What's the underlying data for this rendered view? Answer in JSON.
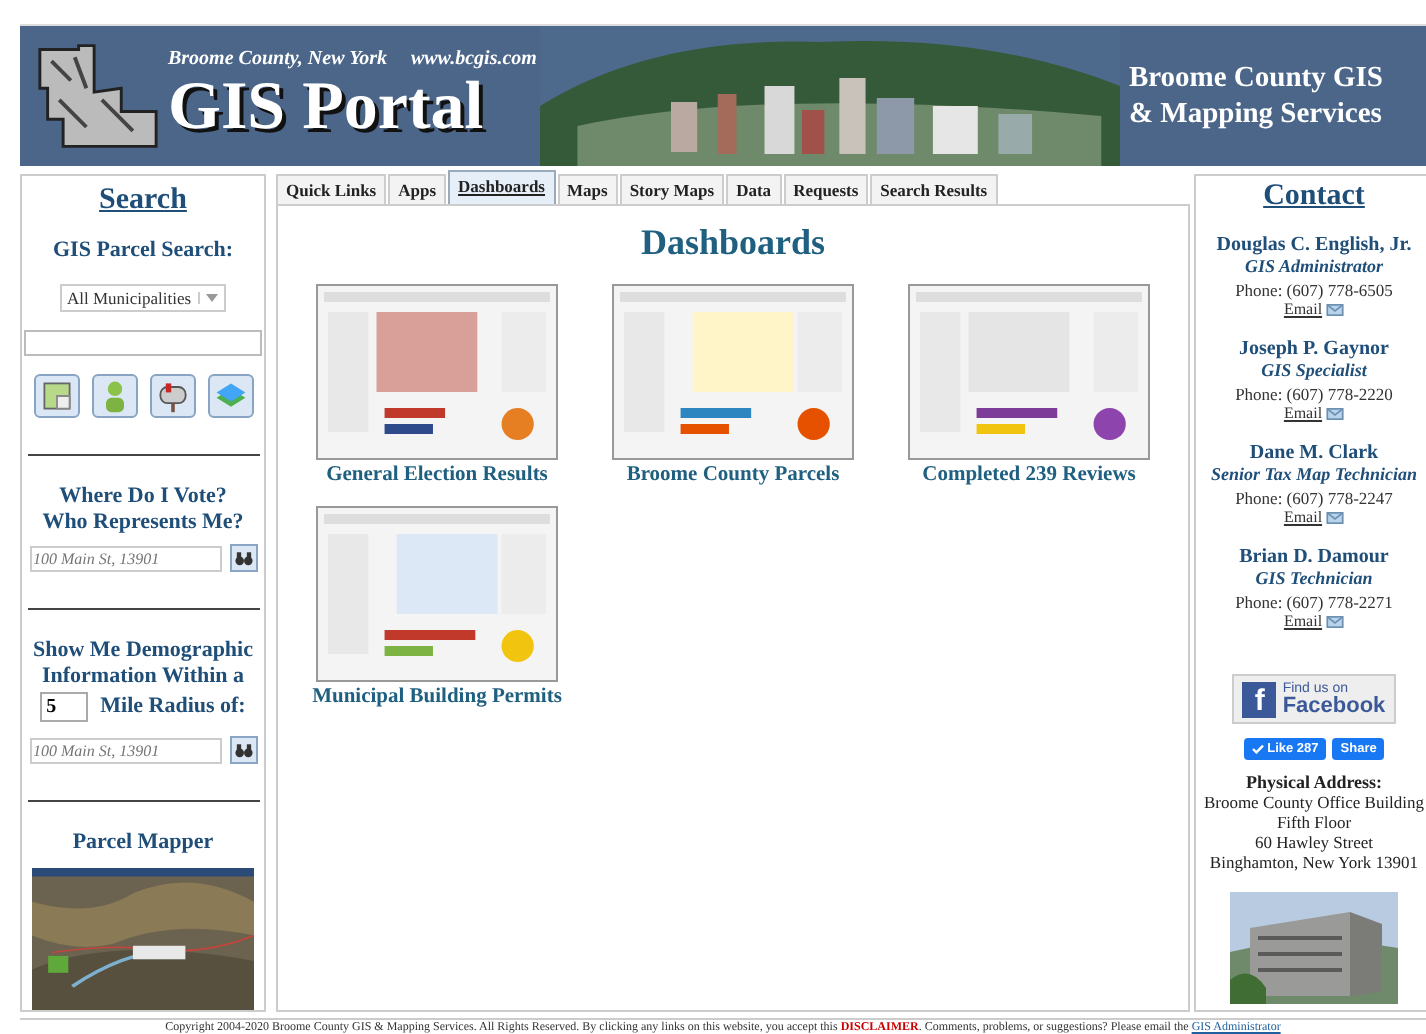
{
  "header": {
    "county": "Broome County, New York",
    "url": "www.bcgis.com",
    "title": "GIS Portal",
    "right_lines": [
      "Broome County GIS",
      "& Mapping Services"
    ]
  },
  "search": {
    "heading": "Search",
    "parcel_label": "GIS Parcel Search:",
    "municipality": "All Municipalities",
    "tools": [
      {
        "kind": "map"
      },
      {
        "kind": "person"
      },
      {
        "kind": "mailbox"
      },
      {
        "kind": "layers"
      }
    ],
    "vote_lines": [
      "Where Do I Vote?",
      "Who Represents Me?"
    ],
    "vote_placeholder": "100 Main St, 13901",
    "demo_line1": "Show Me Demographic Information Within a",
    "radius": "5",
    "demo_line2": "Mile Radius of:",
    "demo_placeholder": "100 Main St, 13901",
    "mapper_title": "Parcel Mapper"
  },
  "tabs": [
    {
      "label": "Quick Links",
      "selected": false
    },
    {
      "label": "Apps",
      "selected": false
    },
    {
      "label": "Dashboards",
      "selected": true
    },
    {
      "label": "Maps",
      "selected": false
    },
    {
      "label": "Story Maps",
      "selected": false
    },
    {
      "label": "Data",
      "selected": false
    },
    {
      "label": "Requests",
      "selected": false
    },
    {
      "label": "Search Results",
      "selected": false
    }
  ],
  "dashboards": {
    "heading": "Dashboards",
    "items": [
      {
        "title": "General Election Results",
        "kind": "picture"
      },
      {
        "title": "Broome County Parcels",
        "kind": "picture"
      },
      {
        "title": "Completed 239 Reviews",
        "kind": "picture"
      },
      {
        "title": "Municipal Building Permits",
        "kind": "picture"
      }
    ]
  },
  "contact": {
    "heading": "Contact",
    "people": [
      {
        "name": "Douglas C. English, Jr.",
        "role": "GIS Administrator",
        "phone": "Phone: (607) 778-6505",
        "email": "Email"
      },
      {
        "name": "Joseph P. Gaynor",
        "role": "GIS Specialist",
        "phone": "Phone: (607) 778-2220",
        "email": "Email"
      },
      {
        "name": "Dane M. Clark",
        "role": "Senior Tax Map Technician",
        "phone": "Phone: (607) 778-2247",
        "email": "Email"
      },
      {
        "name": "Brian D. Damour",
        "role": "GIS Technician",
        "phone": "Phone: (607) 778-2271",
        "email": "Email"
      }
    ],
    "facebook": {
      "logo": "f",
      "line1": "Find us on",
      "line2": "Facebook"
    },
    "like": "Like 287",
    "share": "Share",
    "address_heading": "Physical Address:",
    "address_lines": [
      "Broome County Office Building",
      "Fifth Floor",
      "60 Hawley Street",
      "Binghamton, New York 13901"
    ]
  },
  "footer": {
    "before": "Copyright 2004-2020 Broome County GIS & Mapping Services. All Rights Reserved. By clicking any links on this website, you accept this",
    "disclaimer": "DISCLAIMER",
    "after": ". Comments, problems, or suggestions? Please email the",
    "admin_link": "GIS Administrator"
  }
}
